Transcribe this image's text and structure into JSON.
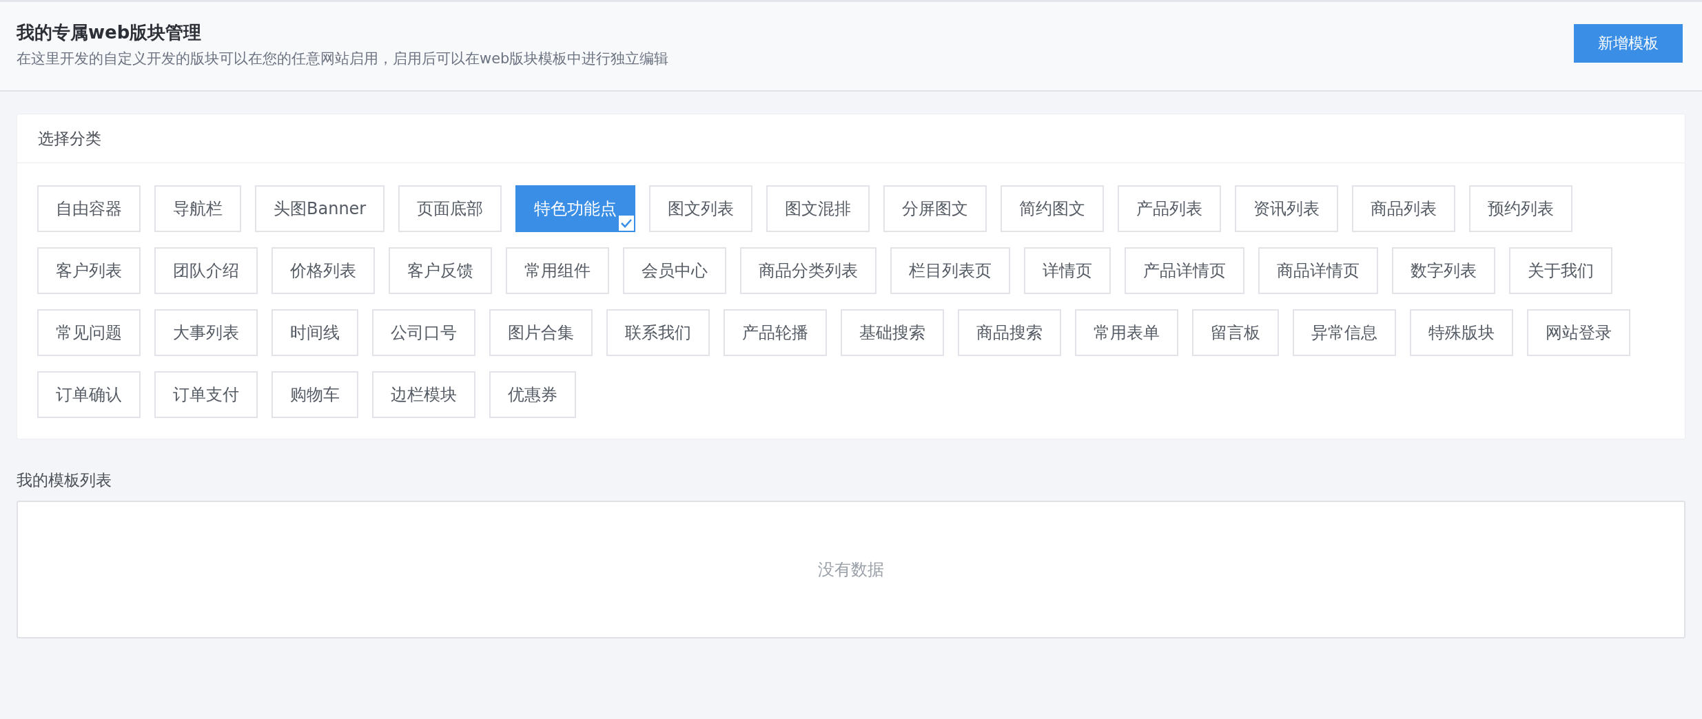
{
  "header": {
    "title": "我的专属web版块管理",
    "subtitle": "在这里开发的自定义开发的版块可以在您的任意网站启用，启用后可以在web版块模板中进行独立编辑",
    "button": "新增模板"
  },
  "category_panel": {
    "title": "选择分类",
    "tags": [
      {
        "label": "自由容器",
        "selected": false
      },
      {
        "label": "导航栏",
        "selected": false
      },
      {
        "label": "头图Banner",
        "selected": false
      },
      {
        "label": "页面底部",
        "selected": false
      },
      {
        "label": "特色功能点",
        "selected": true
      },
      {
        "label": "图文列表",
        "selected": false
      },
      {
        "label": "图文混排",
        "selected": false
      },
      {
        "label": "分屏图文",
        "selected": false
      },
      {
        "label": "简约图文",
        "selected": false
      },
      {
        "label": "产品列表",
        "selected": false
      },
      {
        "label": "资讯列表",
        "selected": false
      },
      {
        "label": "商品列表",
        "selected": false
      },
      {
        "label": "预约列表",
        "selected": false
      },
      {
        "label": "客户列表",
        "selected": false
      },
      {
        "label": "团队介绍",
        "selected": false
      },
      {
        "label": "价格列表",
        "selected": false
      },
      {
        "label": "客户反馈",
        "selected": false
      },
      {
        "label": "常用组件",
        "selected": false
      },
      {
        "label": "会员中心",
        "selected": false
      },
      {
        "label": "商品分类列表",
        "selected": false
      },
      {
        "label": "栏目列表页",
        "selected": false
      },
      {
        "label": "详情页",
        "selected": false
      },
      {
        "label": "产品详情页",
        "selected": false
      },
      {
        "label": "商品详情页",
        "selected": false
      },
      {
        "label": "数字列表",
        "selected": false
      },
      {
        "label": "关于我们",
        "selected": false
      },
      {
        "label": "常见问题",
        "selected": false
      },
      {
        "label": "大事列表",
        "selected": false
      },
      {
        "label": "时间线",
        "selected": false
      },
      {
        "label": "公司口号",
        "selected": false
      },
      {
        "label": "图片合集",
        "selected": false
      },
      {
        "label": "联系我们",
        "selected": false
      },
      {
        "label": "产品轮播",
        "selected": false
      },
      {
        "label": "基础搜索",
        "selected": false
      },
      {
        "label": "商品搜索",
        "selected": false
      },
      {
        "label": "常用表单",
        "selected": false
      },
      {
        "label": "留言板",
        "selected": false
      },
      {
        "label": "异常信息",
        "selected": false
      },
      {
        "label": "特殊版块",
        "selected": false
      },
      {
        "label": "网站登录",
        "selected": false
      },
      {
        "label": "订单确认",
        "selected": false
      },
      {
        "label": "订单支付",
        "selected": false
      },
      {
        "label": "购物车",
        "selected": false
      },
      {
        "label": "边栏模块",
        "selected": false
      },
      {
        "label": "优惠券",
        "selected": false
      }
    ]
  },
  "template_list": {
    "title": "我的模板列表",
    "empty_text": "没有数据"
  }
}
